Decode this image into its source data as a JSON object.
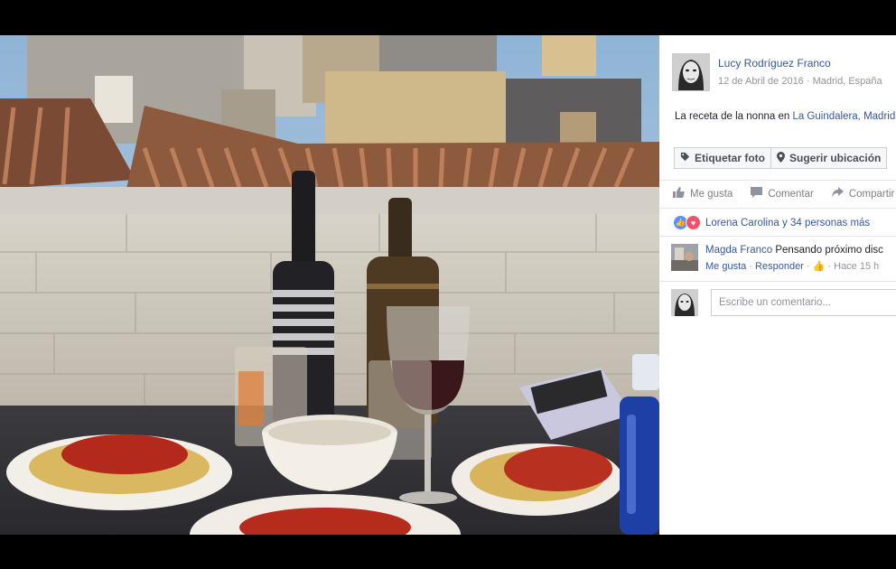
{
  "post": {
    "author_name": "Lucy Rodríguez Franco",
    "date": "12 de Abril de 2016",
    "location": "Madrid, España",
    "meta_separator": " · ",
    "caption_prefix": "La receta de la nonna en ",
    "caption_link": "La Guindalera, Madrid"
  },
  "photo_actions": {
    "tag_label": "Etiquetar foto",
    "location_label": "Sugerir ubicación"
  },
  "actions": {
    "like": "Me gusta",
    "comment": "Comentar",
    "share": "Compartir"
  },
  "reactions": {
    "text": "Lorena Carolina y 34 personas más"
  },
  "comment": {
    "author": "Magda Franco",
    "text": "Pensando próximo disc",
    "like": "Me gusta",
    "reply": "Responder",
    "time": "Hace 15 h",
    "separator": " · "
  },
  "composer": {
    "placeholder": "Escribe un comentario..."
  },
  "colors": {
    "link": "#385898",
    "background": "#000000",
    "panel": "#ffffff"
  },
  "icons": {
    "tag": "tag-icon",
    "location": "map-pin-icon",
    "like": "thumbs-up-icon",
    "comment": "speech-bubble-icon",
    "share": "share-arrow-icon"
  }
}
